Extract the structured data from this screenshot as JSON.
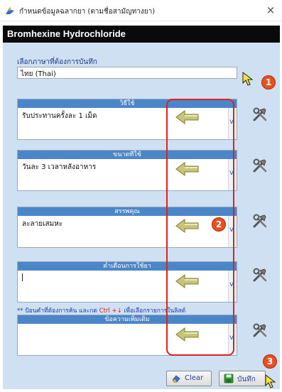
{
  "window": {
    "title": "กำหนดข้อมูลฉลากยา (ตามชื่อสามัญทางยา)",
    "close_glyph": "×"
  },
  "drug": {
    "name": "Bromhexine Hydrochloride"
  },
  "language": {
    "label": "เลือกภาษาที่ต้องการบันทึก",
    "value": "ไทย (Thai)"
  },
  "fields": [
    {
      "header": "วิธีใช้",
      "value": "รับประทานครั้งละ 1 เม็ด"
    },
    {
      "header": "ขนาดที่ใช้",
      "value": "วันละ 3 เวลาหลังอาหาร"
    },
    {
      "header": "สรรพคุณ",
      "value": "ละลายเสมหะ"
    },
    {
      "header": "คำเตือนการใช้ยา",
      "value": ""
    },
    {
      "header": "ข้อความเพิ่มเติม",
      "value": ""
    }
  ],
  "scroll_glyph": "v",
  "hint": {
    "part1": "** ป้อนคำที่ต้องการค้น และกด ",
    "key": "Ctrl +↓",
    "part2": " เพื่อเลือกรายการในลิสต์"
  },
  "buttons": {
    "clear": "Clear",
    "save": "บันทึก"
  },
  "annotations": {
    "badge1": "1",
    "badge2": "2",
    "badge3": "3"
  },
  "colors": {
    "header_blue": "#4a86c8",
    "form_bg": "#cfe0f2",
    "annotation_red": "#e02020",
    "badge_orange": "#e8501e",
    "arrow_olive": "#b3b05a"
  }
}
